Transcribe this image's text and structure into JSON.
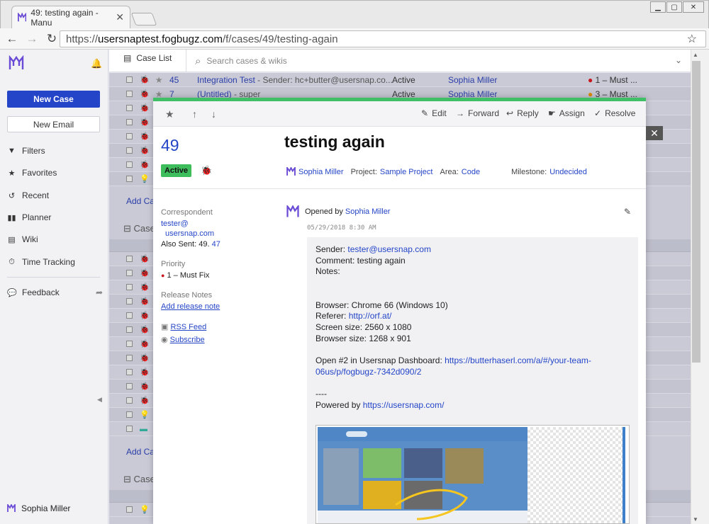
{
  "browser": {
    "tab_title": "49: testing again - Manu",
    "url_scheme": "https://",
    "url_host": "usersnaptest.fogbugz.com",
    "url_path": "/f/cases/49/testing-again"
  },
  "sidebar": {
    "new_case": "New Case",
    "new_email": "New Email",
    "items": [
      {
        "icon": "filter-icon",
        "label": "Filters"
      },
      {
        "icon": "star-icon",
        "label": "Favorites"
      },
      {
        "icon": "history-icon",
        "label": "Recent"
      },
      {
        "icon": "planner-icon",
        "label": "Planner"
      },
      {
        "icon": "wiki-icon",
        "label": "Wiki"
      },
      {
        "icon": "stopwatch-icon",
        "label": "Time Tracking"
      },
      {
        "icon": "chat-icon",
        "label": "Feedback"
      }
    ],
    "user": "Sophia Miller"
  },
  "topbar": {
    "case_list": "Case List",
    "search_placeholder": "Search cases & wikis"
  },
  "background_list": {
    "row1": {
      "id": "45",
      "title": "Integration Test",
      "desc": " - Sender: hc+butter@usersnap.co...",
      "status": "Active",
      "owner": "Sophia Miller",
      "priority": "1 – Must ..."
    },
    "row2": {
      "id": "7",
      "title": "(Untitled)",
      "desc": " - super",
      "status": "Active",
      "owner": "Sophia Miller",
      "priority": "3 – Must ..."
    },
    "add_case": "Add Ca",
    "group": "Case"
  },
  "modal": {
    "toolbar": {
      "edit": "Edit",
      "forward": "Forward",
      "reply": "Reply",
      "assign": "Assign",
      "resolve": "Resolve"
    },
    "case_number": "49",
    "title": "testing again",
    "status": "Active",
    "owner": "Sophia Miller",
    "project_label": "Project:",
    "project": "Sample Project",
    "area_label": "Area:",
    "area": "Code",
    "milestone_label": "Milestone:",
    "milestone": "Undecided",
    "correspondent_label": "Correspondent",
    "correspondent_1": "tester@",
    "correspondent_2": "usersnap.com",
    "also_sent_label": "Also Sent:",
    "also_sent_1": "49",
    "also_sent_2": "47",
    "priority_label": "Priority",
    "priority": "1 – Must Fix",
    "release_notes_label": "Release Notes",
    "add_release_note": "Add release note",
    "rss": "RSS Feed",
    "subscribe": "Subscribe",
    "event": {
      "opened_by": "Opened by",
      "opener": "Sophia Miller",
      "date": "05/29/2018 8:30 AM",
      "sender_label": "Sender: ",
      "sender": "tester@usersnap.com",
      "comment": "Comment: testing again",
      "notes": "Notes:",
      "browser": "Browser: Chrome 66 (Windows 10)",
      "referer_label": "Referer: ",
      "referer": "http://orf.at/",
      "screen": "Screen size: 2560 x 1080",
      "browser_size": "Browser size: 1268 x 901",
      "dashboard_label": "Open #2 in Usersnap Dashboard: ",
      "dashboard_url": "https://butterhaserl.com/a/#/your-team-06us/p/fogbugz-7342d090/2",
      "separator": "----",
      "powered_label": "Powered by ",
      "powered_url": "https://usersnap.com/"
    }
  },
  "colors": {
    "accent": "#2445c7",
    "active": "#3ebd5c",
    "bug": "#c7171f",
    "modal_top": "#3fbf66"
  }
}
